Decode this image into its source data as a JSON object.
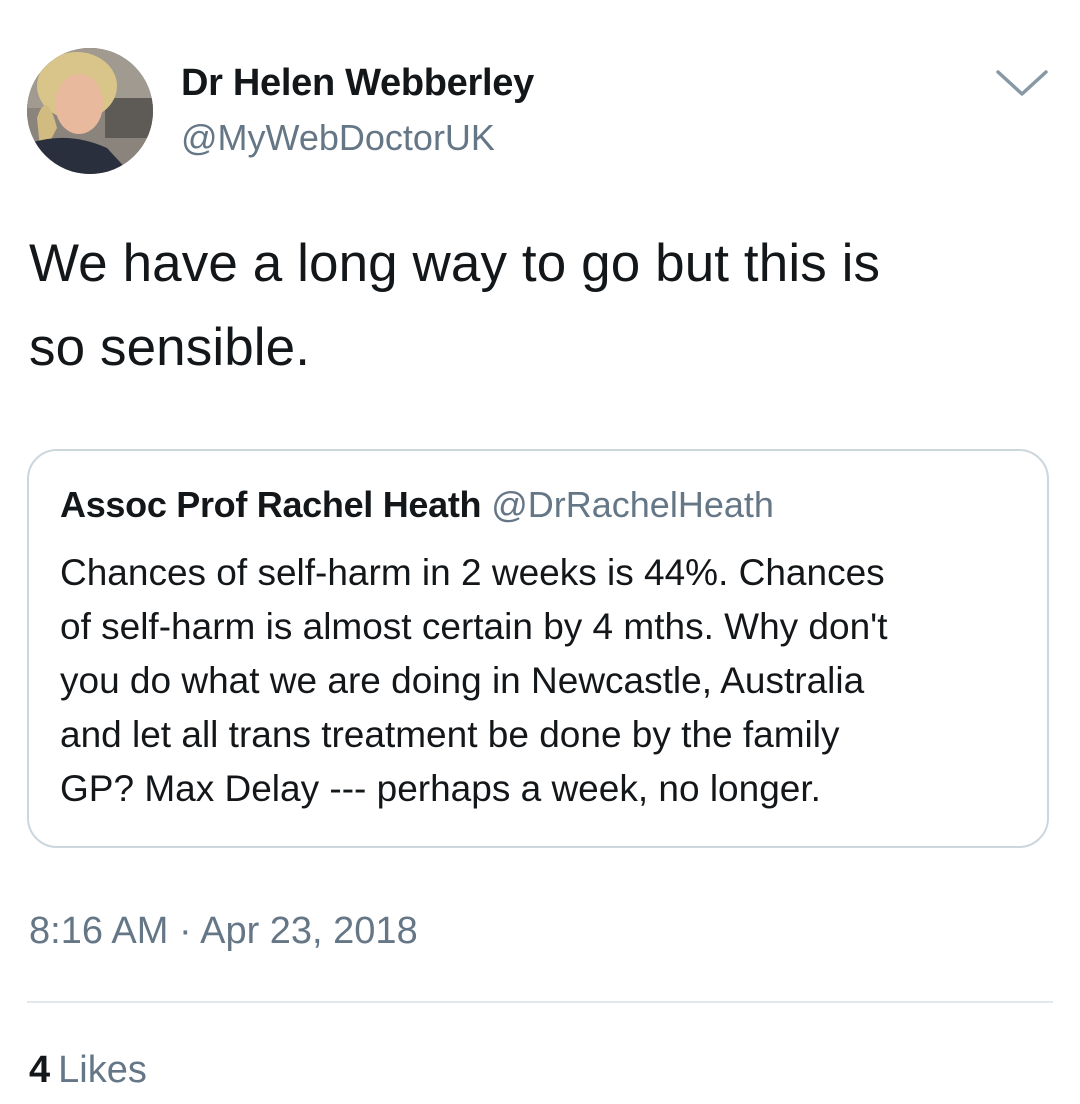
{
  "tweet": {
    "author": {
      "name": "Dr Helen Webberley",
      "handle": "@MyWebDoctorUK",
      "avatar_icon": "profile-photo"
    },
    "more_icon": "chevron-down-icon",
    "text": "We have a long way to go but this is\nso sensible.",
    "quoted_tweet": {
      "author_name": "Assoc Prof Rachel Heath",
      "author_handle": "@DrRachelHeath",
      "text": "Chances of self-harm in 2 weeks is 44%. Chances\nof self-harm is almost certain by 4 mths. Why don't\nyou do what we are doing in Newcastle, Australia\nand let all trans treatment be done by the family\nGP? Max Delay --- perhaps a week, no longer."
    },
    "timestamp": "8:16 AM · Apr 23, 2018",
    "stats": {
      "likes_count": "4",
      "likes_label": "Likes"
    }
  },
  "colors": {
    "text_primary": "#14171a",
    "text_secondary": "#657786",
    "border": "#ccd6dd",
    "divider": "#e1e8ed"
  }
}
